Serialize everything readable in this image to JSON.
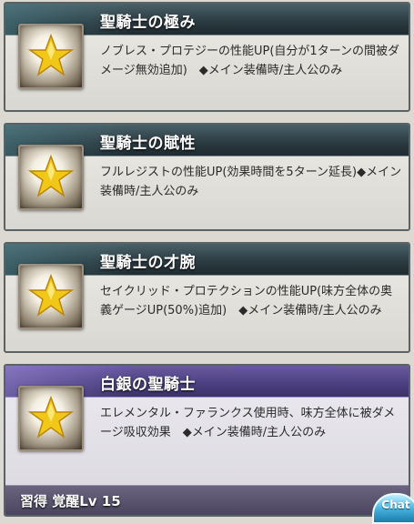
{
  "skills": [
    {
      "title": "聖騎士の極み",
      "desc": "ノブレス・プロテジーの性能UP(自分が1ターンの間被ダメージ無効追加)　◆メイン装備時/主人公のみ",
      "icon": "star-icon"
    },
    {
      "title": "聖騎士の賦性",
      "desc": "フルレジストの性能UP(効果時間を5ターン延長)◆メイン装備時/主人公のみ",
      "icon": "star-icon"
    },
    {
      "title": "聖騎士の才腕",
      "desc": "セイクリッド・プロテクションの性能UP(味方全体の奥義ゲージUP(50%)追加)　◆メイン装備時/主人公のみ",
      "icon": "star-icon"
    },
    {
      "title": "白銀の聖騎士",
      "desc": "エレメンタル・ファランクス使用時、味方全体に被ダメージ吸収効果　◆メイン装備時/主人公のみ",
      "icon": "star-icon",
      "footer": "習得 覚醒Lv 15"
    }
  ],
  "chat_label": "Chat",
  "colors": {
    "header_dark": "#2a3a40",
    "header_purple": "#4b3f80",
    "star_gold": "#f2c818"
  }
}
